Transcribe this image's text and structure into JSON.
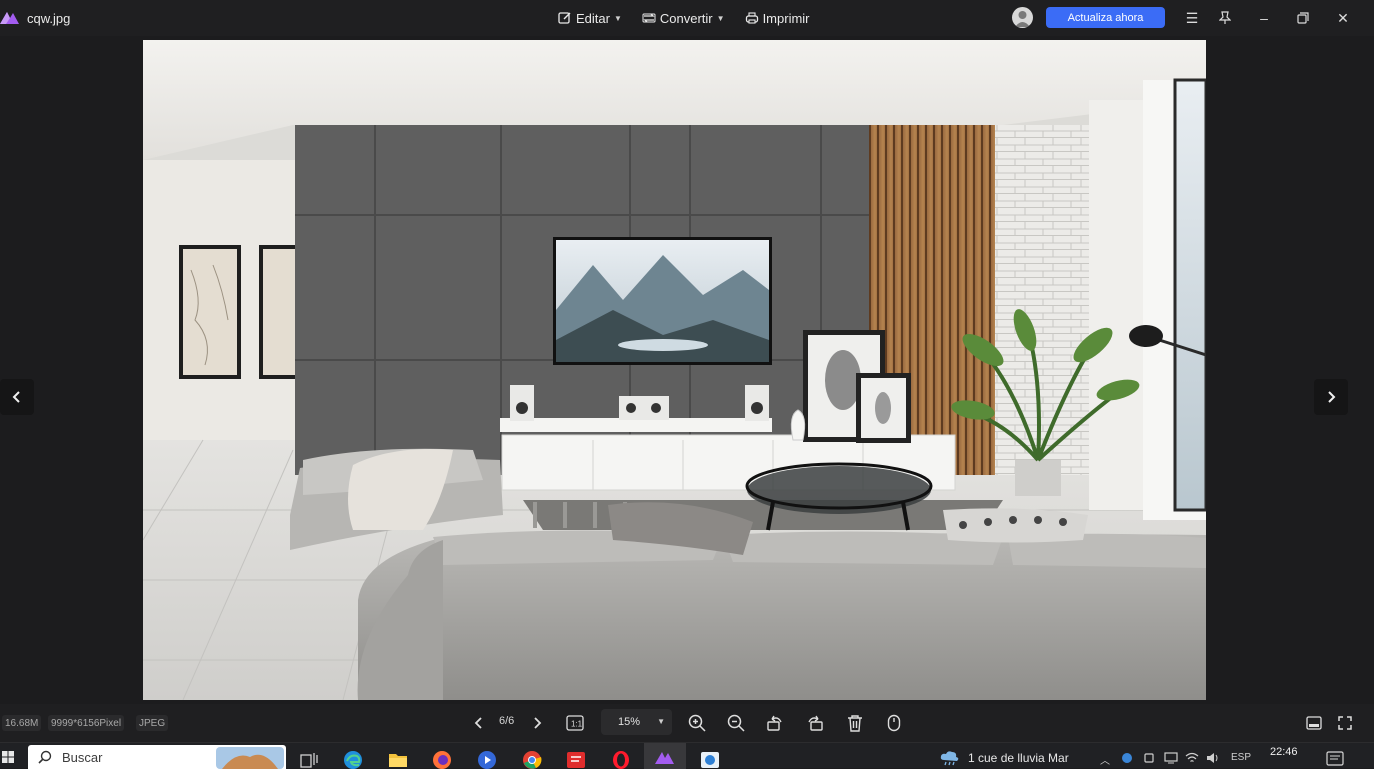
{
  "app": {
    "file_name": "cqw.jpg"
  },
  "toolbar": {
    "edit_label": "Editar",
    "convert_label": "Convertir",
    "print_label": "Imprimir",
    "upgrade_label": "Actualiza ahora"
  },
  "image_info": {
    "size": "16.68M",
    "dimensions": "9999*6156Pixel",
    "format": "JPEG"
  },
  "navigation": {
    "page_indicator": "6/6"
  },
  "zoom": {
    "value": "15%"
  },
  "taskbar": {
    "search_placeholder": "Buscar",
    "weather": "1 cue de lluvia Mar",
    "language": "ESP",
    "time": "22:46"
  },
  "colors": {
    "accent": "#3b6cf6",
    "app_logo": "#a35cf0",
    "background": "#1c1c1e"
  }
}
